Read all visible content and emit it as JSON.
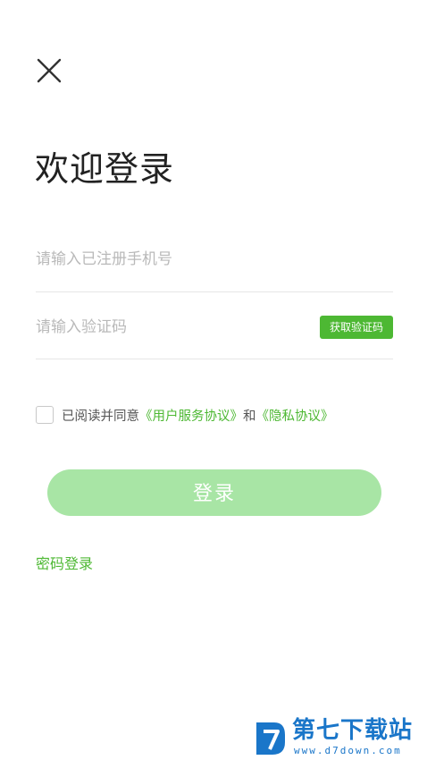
{
  "header": {
    "close_icon": "close-icon"
  },
  "page_title": "欢迎登录",
  "phone_field": {
    "placeholder": "请输入已注册手机号",
    "value": ""
  },
  "code_field": {
    "placeholder": "请输入验证码",
    "value": "",
    "get_code_label": "获取验证码"
  },
  "agreement": {
    "checked": false,
    "prefix": "已阅读并同意",
    "user_agreement": "《用户服务协议》",
    "conjunction": "和",
    "privacy_agreement": "《隐私协议》"
  },
  "login_button_label": "登录",
  "password_login_label": "密码登录",
  "watermark": {
    "title": "第七下载站",
    "url": "www.d7down.com"
  },
  "colors": {
    "accent": "#4db833",
    "login_button_disabled": "#a8e5a5",
    "placeholder": "#b9b9b9",
    "watermark": "#1a76c9"
  }
}
